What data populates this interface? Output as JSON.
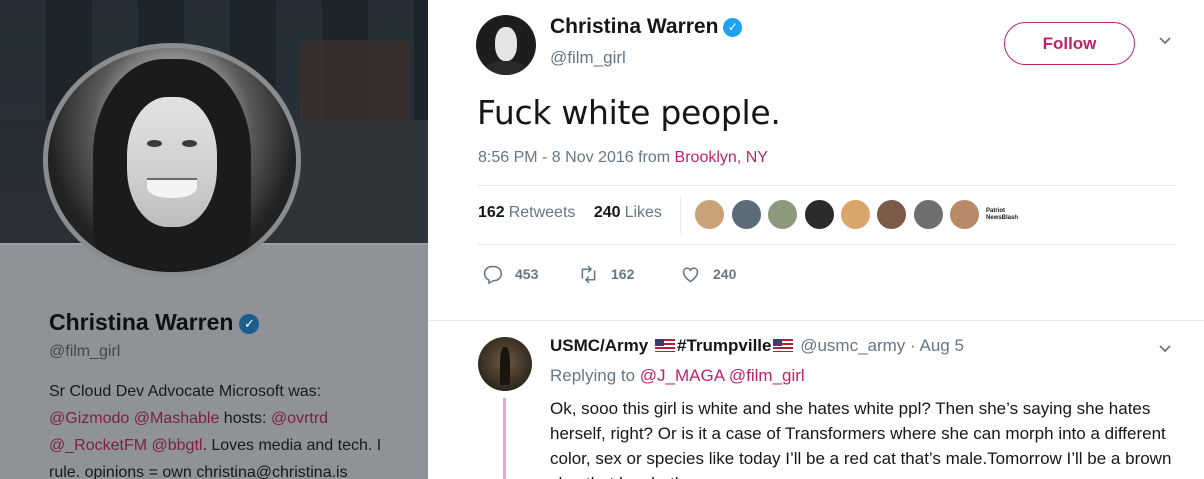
{
  "profile": {
    "name": "Christina Warren",
    "handle": "@film_girl",
    "bio_line1_prefix": "Sr Cloud Dev Advocate Microsoft was:",
    "bio_mentions1": [
      "@Gizmodo",
      "@Mashable"
    ],
    "bio_hosts_label": "hosts:",
    "bio_mentions2": [
      "@ovrtrd",
      "@_RocketFM",
      "@bbgtl"
    ],
    "bio_suffix1": ". Loves media and tech. I",
    "bio_suffix2": "rule. opinions = own christina@christina.is"
  },
  "tweet": {
    "author_name": "Christina Warren",
    "author_handle": "@film_girl",
    "follow_label": "Follow",
    "text": "Fuck white people.",
    "time": "8:56 PM - 8 Nov 2016 from",
    "location": "Brooklyn, NY",
    "retweets_count": "162",
    "retweets_label": "Retweets",
    "likes_count": "240",
    "likes_label": "Likes",
    "liker_caption": "Patriot NewsBlash",
    "liker_colors": [
      "#c9a27a",
      "#5d6b78",
      "#8a9a7a",
      "#2b2b2b",
      "#d8a56a",
      "#7b5a4a",
      "#6e6e6e",
      "#b78a6a"
    ],
    "actions": {
      "replies": "453",
      "retweets": "162",
      "likes": "240"
    }
  },
  "reply": {
    "name": "USMC/Army",
    "tag": "#Trumpville",
    "handle": "@usmc_army",
    "dot": "·",
    "date": "Aug 5",
    "replying_label": "Replying to",
    "replying_to": [
      "@J_MAGA",
      "@film_girl"
    ],
    "text": "Ok, sooo this girl is white and she hates white ppl? Then she’s saying she hates herself, right? Or is it a case of Transformers where she can morph into a different color, sex or species like today I’ll be a red cat that’s male.Tomorrow I’ll be a brown slug that has both sexes"
  }
}
